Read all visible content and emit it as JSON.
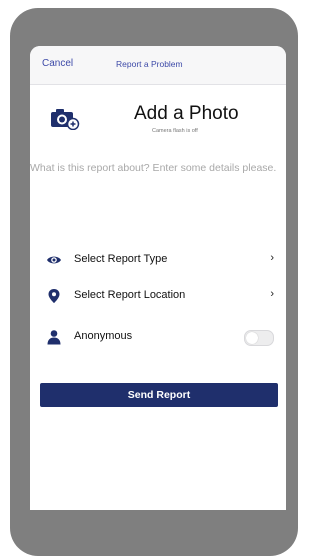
{
  "navbar": {
    "cancel_label": "Cancel",
    "title": "Report a Problem"
  },
  "photo": {
    "icon": "camera-icon",
    "title": "Add a Photo",
    "subtitle": "Camera flash is off"
  },
  "details": {
    "placeholder": "What is this report about? Enter some details please."
  },
  "options": [
    {
      "label": "Select Report Type",
      "icon": "eye-icon",
      "trailing": "›"
    },
    {
      "label": "Select Report Location",
      "icon": "location-pin-icon",
      "trailing": "›"
    },
    {
      "label": "Anonymous",
      "icon": "person-icon",
      "toggle_on": false
    }
  ],
  "send_button": {
    "label": "Send Report"
  },
  "colors": {
    "accent": "#1f2f6c",
    "link": "#3d4aa8",
    "frame": "#7f7f7f"
  }
}
